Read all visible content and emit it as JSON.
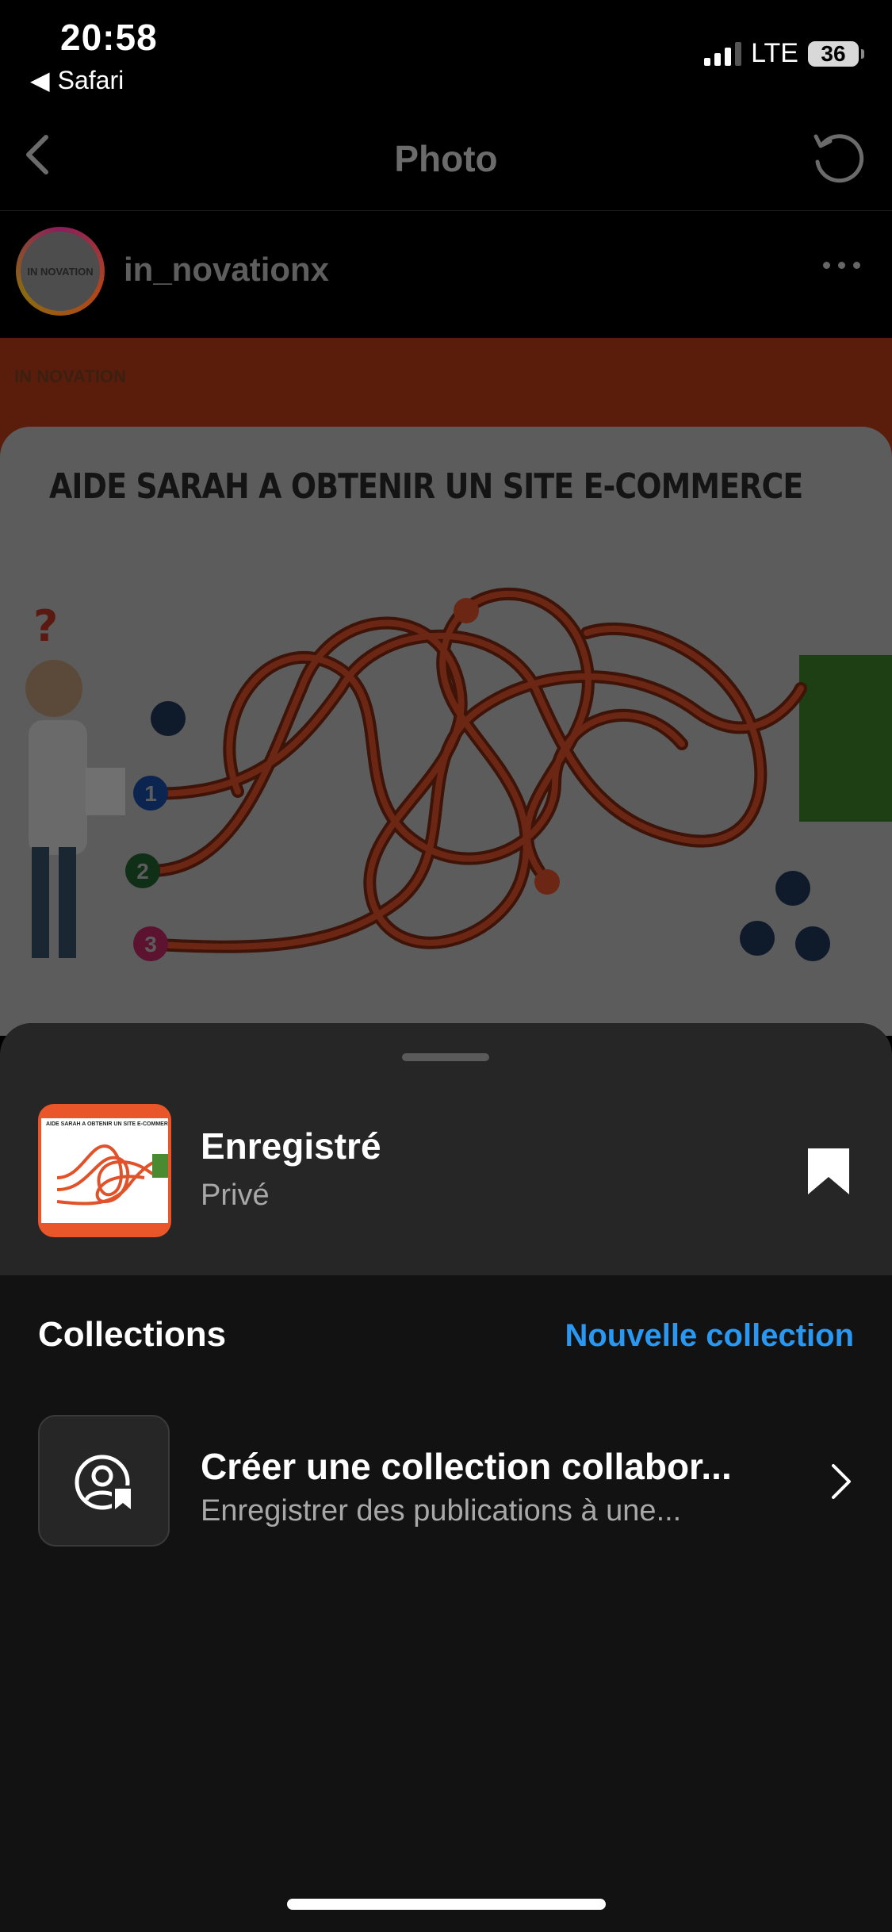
{
  "status_bar": {
    "time": "20:58",
    "back_app": "Safari",
    "network": "LTE",
    "battery": "36"
  },
  "nav": {
    "title": "Photo",
    "back_icon": "chevron-left-icon",
    "refresh_icon": "refresh-icon"
  },
  "post": {
    "username": "in_novationx",
    "logo_text": "IN NOVATION",
    "image_title": "AIDE SARAH  A  OBTENIR UN SITE E-COMMERCE",
    "maze_numbers": [
      "1",
      "2",
      "3"
    ]
  },
  "sheet": {
    "saved_title": "Enregistré",
    "saved_subtitle": "Privé",
    "collections_label": "Collections",
    "new_collection": "Nouvelle collection",
    "collab_title": "Créer une collection collabor...",
    "collab_subtitle": "Enregistrer des publications à une...",
    "thumb_title": "AIDE SARAH  A  OBTENIR UN SITE E-COMMERCE"
  },
  "colors": {
    "accent_blue": "#2a97f0",
    "sheet_bg": "#262626",
    "page_bg": "#121212",
    "post_orange": "#e8562a"
  }
}
